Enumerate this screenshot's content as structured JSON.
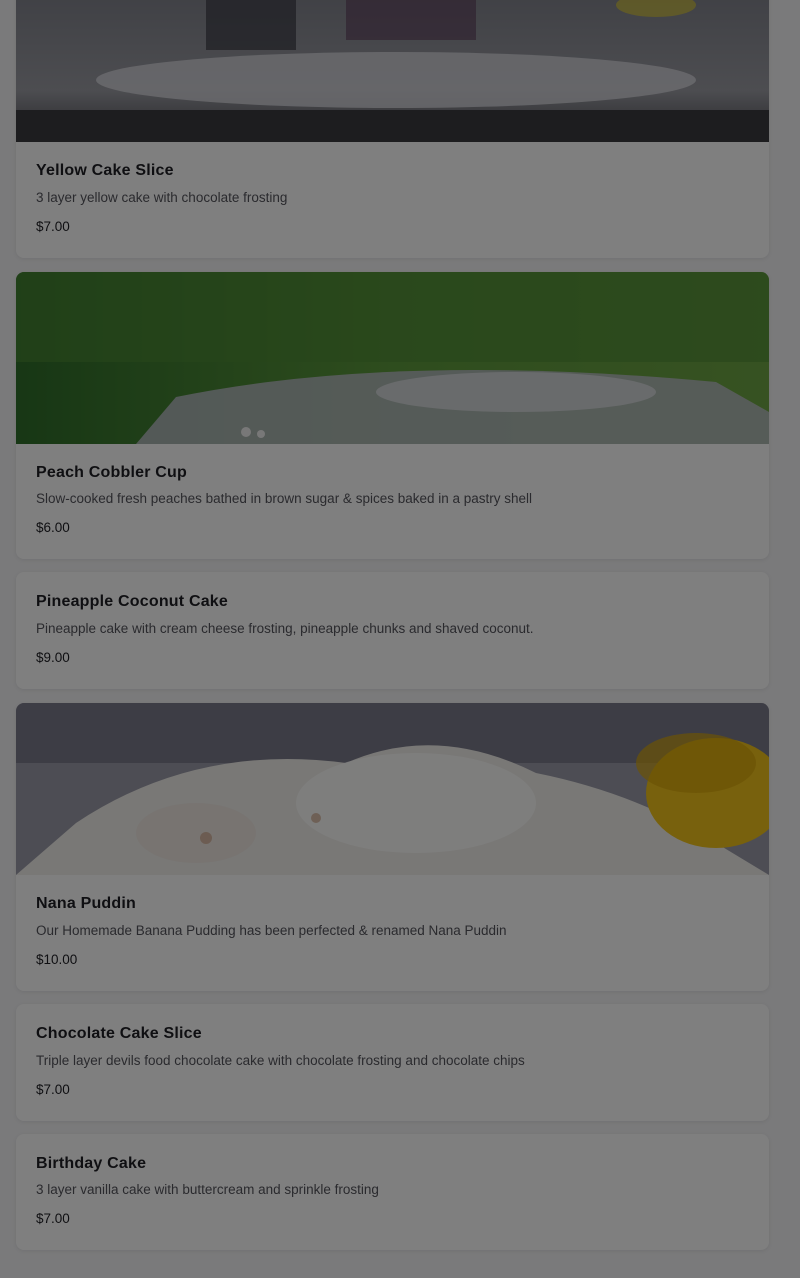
{
  "menu_items": [
    {
      "name": "Yellow Cake Slice",
      "description": "3 layer yellow cake with chocolate frosting",
      "price": "$7.00"
    },
    {
      "name": "Peach Cobbler Cup",
      "description": "Slow-cooked fresh peaches bathed in brown sugar & spices baked in a pastry shell",
      "price": "$6.00"
    },
    {
      "name": "Pineapple Coconut Cake",
      "description": "Pineapple cake with cream cheese frosting, pineapple chunks and shaved coconut.",
      "price": "$9.00"
    },
    {
      "name": "Nana Puddin",
      "description": "Our Homemade Banana Pudding has been perfected & renamed Nana Puddin",
      "price": "$10.00"
    },
    {
      "name": "Chocolate Cake Slice",
      "description": "Triple layer devils food chocolate cake with chocolate frosting and chocolate chips",
      "price": "$7.00"
    },
    {
      "name": "Birthday Cake",
      "description": "3 layer vanilla cake with buttercream and sprinkle frosting",
      "price": "$7.00"
    }
  ],
  "colors": {
    "overlay": "#000000",
    "card_background": "#ffffff",
    "title_text": "#1f1f24",
    "description_text": "#55555c"
  }
}
